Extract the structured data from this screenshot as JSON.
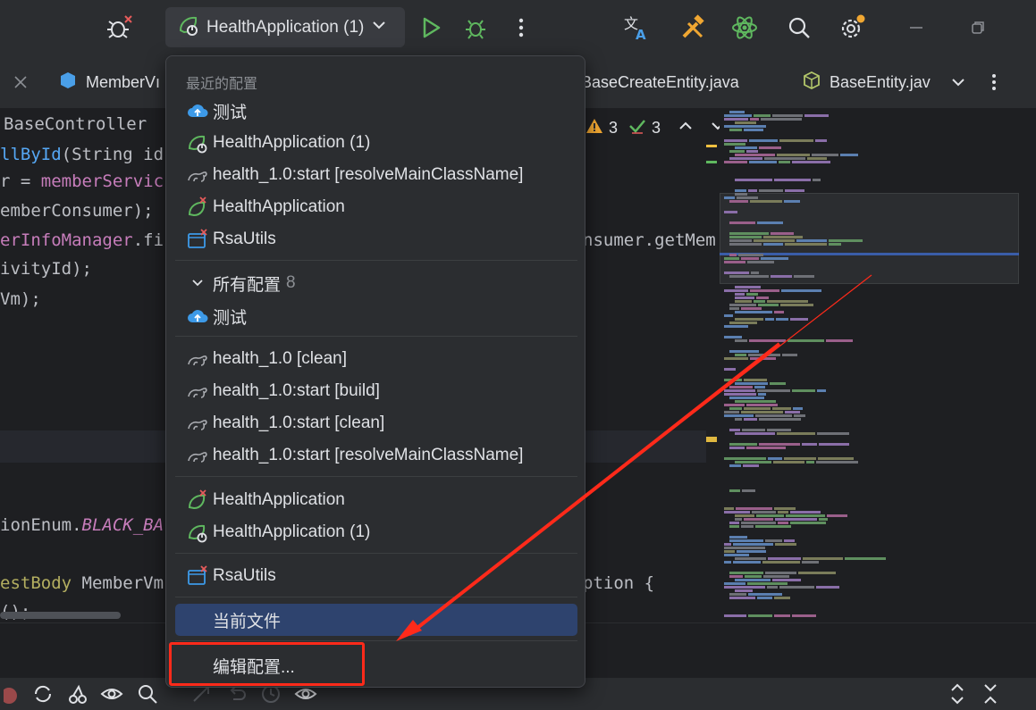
{
  "toolbar": {
    "run_config_label": "HealthApplication (1)"
  },
  "tabs": [
    {
      "label": "MemberVı"
    },
    {
      "label": "BaseCreateEntity.java"
    },
    {
      "label": "BaseEntity.jav"
    }
  ],
  "editor": {
    "lines": [
      {
        "segments": [
          "BaseController"
        ]
      },
      {
        "segments": [
          "llById",
          "(String id"
        ]
      },
      {
        "segments": [
          "r = ",
          "memberServic"
        ]
      },
      {
        "segments": [
          "emberConsumer);"
        ]
      },
      {
        "segments": [
          "erInfoManager",
          ".fi"
        ]
      },
      {
        "segments": [
          "ivityId);"
        ]
      },
      {
        "segments": [
          "Vm);"
        ]
      },
      {
        "segments": [
          "ionEnum.",
          "BLACK_BA"
        ]
      },
      {
        "segments": [
          "estBody",
          " MemberVm"
        ]
      },
      {
        "segments": [
          "();"
        ]
      }
    ],
    "right_fragments": {
      "consumer": "nsumer.getMem",
      "ption": "ption {"
    },
    "inspection": {
      "warnings": "3",
      "checks": "3"
    }
  },
  "popup": {
    "recent_header": "最近的配置",
    "recent_items": [
      {
        "label": "测试",
        "icon": "cloud-upload-icon"
      },
      {
        "label": "HealthApplication (1)",
        "icon": "spring-boot-icon"
      },
      {
        "label": "health_1.0:start [resolveMainClassName]",
        "icon": "gradle-icon"
      },
      {
        "label": "HealthApplication",
        "icon": "spring-boot-error-icon"
      },
      {
        "label": "RsaUtils",
        "icon": "java-app-error-icon"
      }
    ],
    "all_header": "所有配置",
    "all_count": "8",
    "all_items_group1": [
      {
        "label": "测试",
        "icon": "cloud-upload-icon"
      }
    ],
    "all_items_group2": [
      {
        "label": "health_1.0 [clean]",
        "icon": "gradle-icon"
      },
      {
        "label": "health_1.0:start [build]",
        "icon": "gradle-icon"
      },
      {
        "label": "health_1.0:start [clean]",
        "icon": "gradle-icon"
      },
      {
        "label": "health_1.0:start [resolveMainClassName]",
        "icon": "gradle-icon"
      }
    ],
    "all_items_group3": [
      {
        "label": "HealthApplication",
        "icon": "spring-boot-error-icon"
      },
      {
        "label": "HealthApplication (1)",
        "icon": "spring-boot-icon"
      }
    ],
    "all_items_group4": [
      {
        "label": "RsaUtils",
        "icon": "java-app-error-icon"
      }
    ],
    "current_file": "当前文件",
    "edit_configs": "编辑配置..."
  },
  "colors": {
    "accent_green": "#5fb85f",
    "selection": "#2e436e",
    "annotation_red": "#ff2a1a"
  }
}
